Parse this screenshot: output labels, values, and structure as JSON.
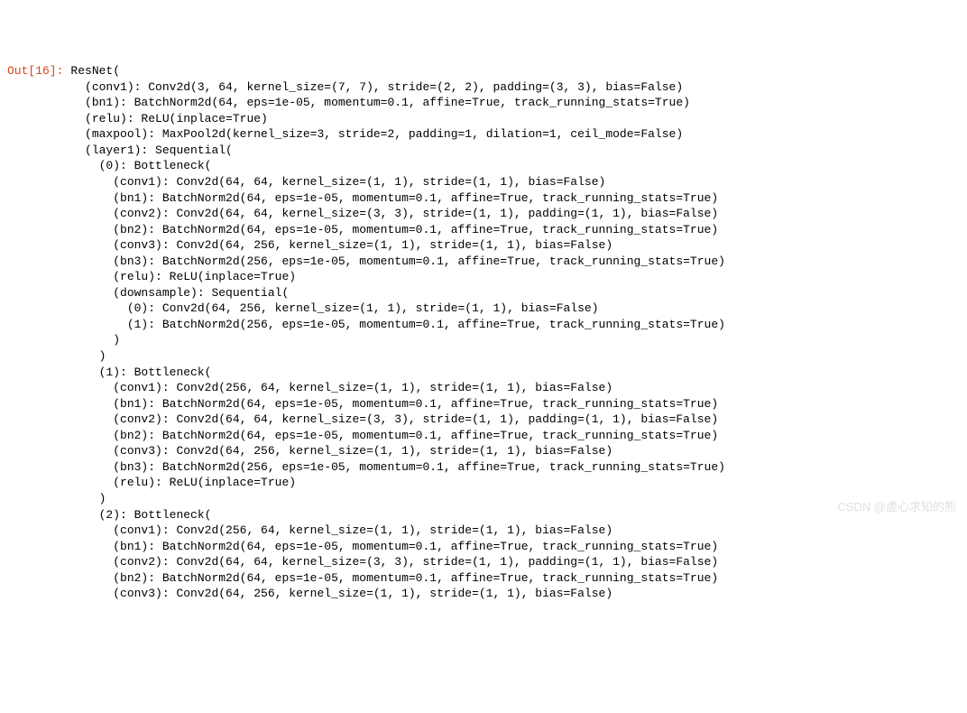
{
  "prompt": "Out[16]:",
  "watermark": "CSDN @虚心求知的熊",
  "lines": [
    "ResNet(",
    "  (conv1): Conv2d(3, 64, kernel_size=(7, 7), stride=(2, 2), padding=(3, 3), bias=False)",
    "  (bn1): BatchNorm2d(64, eps=1e-05, momentum=0.1, affine=True, track_running_stats=True)",
    "  (relu): ReLU(inplace=True)",
    "  (maxpool): MaxPool2d(kernel_size=3, stride=2, padding=1, dilation=1, ceil_mode=False)",
    "  (layer1): Sequential(",
    "    (0): Bottleneck(",
    "      (conv1): Conv2d(64, 64, kernel_size=(1, 1), stride=(1, 1), bias=False)",
    "      (bn1): BatchNorm2d(64, eps=1e-05, momentum=0.1, affine=True, track_running_stats=True)",
    "      (conv2): Conv2d(64, 64, kernel_size=(3, 3), stride=(1, 1), padding=(1, 1), bias=False)",
    "      (bn2): BatchNorm2d(64, eps=1e-05, momentum=0.1, affine=True, track_running_stats=True)",
    "      (conv3): Conv2d(64, 256, kernel_size=(1, 1), stride=(1, 1), bias=False)",
    "      (bn3): BatchNorm2d(256, eps=1e-05, momentum=0.1, affine=True, track_running_stats=True)",
    "      (relu): ReLU(inplace=True)",
    "      (downsample): Sequential(",
    "        (0): Conv2d(64, 256, kernel_size=(1, 1), stride=(1, 1), bias=False)",
    "        (1): BatchNorm2d(256, eps=1e-05, momentum=0.1, affine=True, track_running_stats=True)",
    "      )",
    "    )",
    "    (1): Bottleneck(",
    "      (conv1): Conv2d(256, 64, kernel_size=(1, 1), stride=(1, 1), bias=False)",
    "      (bn1): BatchNorm2d(64, eps=1e-05, momentum=0.1, affine=True, track_running_stats=True)",
    "      (conv2): Conv2d(64, 64, kernel_size=(3, 3), stride=(1, 1), padding=(1, 1), bias=False)",
    "      (bn2): BatchNorm2d(64, eps=1e-05, momentum=0.1, affine=True, track_running_stats=True)",
    "      (conv3): Conv2d(64, 256, kernel_size=(1, 1), stride=(1, 1), bias=False)",
    "      (bn3): BatchNorm2d(256, eps=1e-05, momentum=0.1, affine=True, track_running_stats=True)",
    "      (relu): ReLU(inplace=True)",
    "    )",
    "    (2): Bottleneck(",
    "      (conv1): Conv2d(256, 64, kernel_size=(1, 1), stride=(1, 1), bias=False)",
    "      (bn1): BatchNorm2d(64, eps=1e-05, momentum=0.1, affine=True, track_running_stats=True)",
    "      (conv2): Conv2d(64, 64, kernel_size=(3, 3), stride=(1, 1), padding=(1, 1), bias=False)",
    "      (bn2): BatchNorm2d(64, eps=1e-05, momentum=0.1, affine=True, track_running_stats=True)",
    "      (conv3): Conv2d(64, 256, kernel_size=(1, 1), stride=(1, 1), bias=False)"
  ]
}
